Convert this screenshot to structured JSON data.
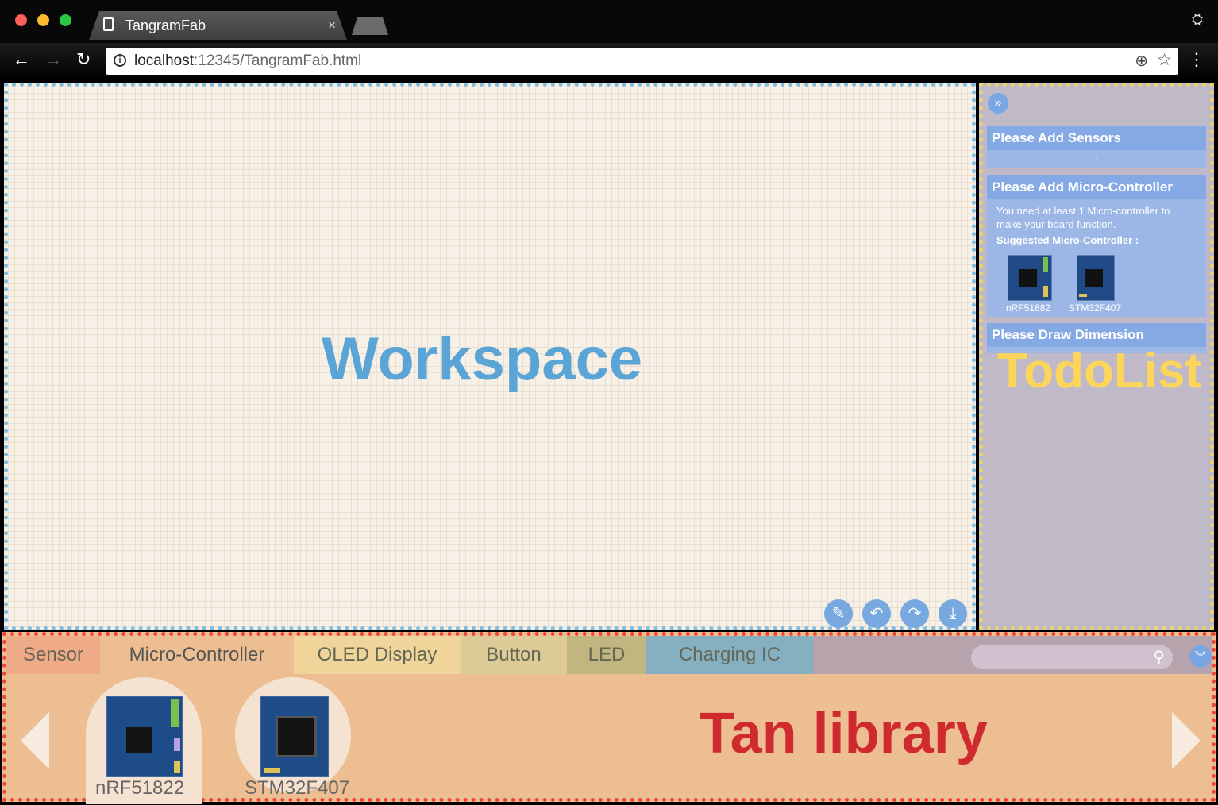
{
  "browser": {
    "tab_title": "TangramFab",
    "tab_close": "×",
    "url_host": "localhost",
    "url_path": ":12345/TangramFab.html"
  },
  "workspace": {
    "label": "Workspace"
  },
  "todo": {
    "label": "TodoList",
    "sensors_header": "Please Add Sensors",
    "mcu_header": "Please Add Micro-Controller",
    "mcu_description": "You need at least 1 Micro-controller to make your board function.",
    "mcu_suggested": "Suggested Micro-Controller :",
    "mcu_options": [
      "nRF51882",
      "STM32F407"
    ],
    "dimension_header": "Please Draw Dimension"
  },
  "library": {
    "label": "Tan library",
    "tabs": [
      "Sensor",
      "Micro-Controller",
      "OLED Display",
      "Button",
      "LED",
      "Charging IC"
    ],
    "items": [
      "nRF51822",
      "STM32F407"
    ]
  },
  "colors": {
    "workspace_border": "#7fbde2",
    "todo_border": "#f0d36a",
    "library_border": "#ee4638",
    "accent_blue": "#78a8e0"
  }
}
